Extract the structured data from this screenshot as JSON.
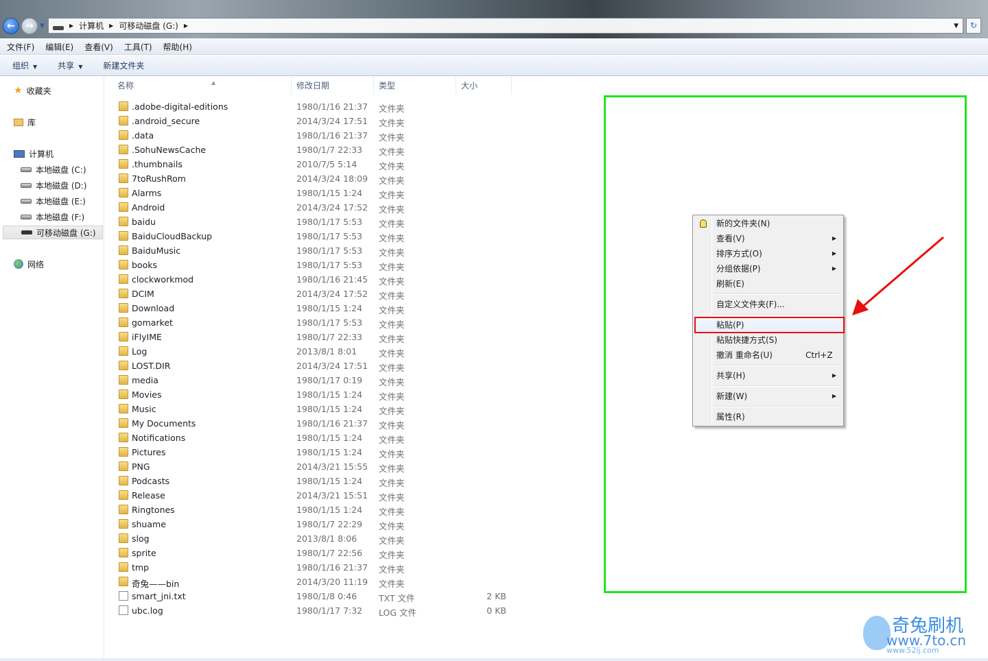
{
  "address": {
    "crumbs": [
      "计算机",
      "可移动磁盘 (G:)"
    ]
  },
  "menubar": [
    "文件(F)",
    "编辑(E)",
    "查看(V)",
    "工具(T)",
    "帮助(H)"
  ],
  "toolbar": {
    "organize": "组织",
    "share": "共享",
    "new_folder": "新建文件夹"
  },
  "sidebar": {
    "favorites": "收藏夹",
    "libraries": "库",
    "computer": "计算机",
    "drives": [
      "本地磁盘 (C:)",
      "本地磁盘 (D:)",
      "本地磁盘 (E:)",
      "本地磁盘 (F:)",
      "可移动磁盘 (G:)"
    ],
    "network": "网络"
  },
  "columns": {
    "name": "名称",
    "date": "修改日期",
    "type": "类型",
    "size": "大小"
  },
  "files": [
    {
      "name": ".adobe-digital-editions",
      "date": "1980/1/16 21:37",
      "type": "文件夹",
      "size": "",
      "kind": "folder"
    },
    {
      "name": ".android_secure",
      "date": "2014/3/24 17:51",
      "type": "文件夹",
      "size": "",
      "kind": "folder"
    },
    {
      "name": ".data",
      "date": "1980/1/16 21:37",
      "type": "文件夹",
      "size": "",
      "kind": "folder"
    },
    {
      "name": ".SohuNewsCache",
      "date": "1980/1/7 22:33",
      "type": "文件夹",
      "size": "",
      "kind": "folder"
    },
    {
      "name": ".thumbnails",
      "date": "2010/7/5 5:14",
      "type": "文件夹",
      "size": "",
      "kind": "folder"
    },
    {
      "name": "7toRushRom",
      "date": "2014/3/24 18:09",
      "type": "文件夹",
      "size": "",
      "kind": "folder"
    },
    {
      "name": "Alarms",
      "date": "1980/1/15 1:24",
      "type": "文件夹",
      "size": "",
      "kind": "folder"
    },
    {
      "name": "Android",
      "date": "2014/3/24 17:52",
      "type": "文件夹",
      "size": "",
      "kind": "folder"
    },
    {
      "name": "baidu",
      "date": "1980/1/17 5:53",
      "type": "文件夹",
      "size": "",
      "kind": "folder"
    },
    {
      "name": "BaiduCloudBackup",
      "date": "1980/1/17 5:53",
      "type": "文件夹",
      "size": "",
      "kind": "folder"
    },
    {
      "name": "BaiduMusic",
      "date": "1980/1/17 5:53",
      "type": "文件夹",
      "size": "",
      "kind": "folder"
    },
    {
      "name": "books",
      "date": "1980/1/17 5:53",
      "type": "文件夹",
      "size": "",
      "kind": "folder"
    },
    {
      "name": "clockworkmod",
      "date": "1980/1/16 21:45",
      "type": "文件夹",
      "size": "",
      "kind": "folder"
    },
    {
      "name": "DCIM",
      "date": "2014/3/24 17:52",
      "type": "文件夹",
      "size": "",
      "kind": "folder"
    },
    {
      "name": "Download",
      "date": "1980/1/15 1:24",
      "type": "文件夹",
      "size": "",
      "kind": "folder"
    },
    {
      "name": "gomarket",
      "date": "1980/1/17 5:53",
      "type": "文件夹",
      "size": "",
      "kind": "folder"
    },
    {
      "name": "iFlyIME",
      "date": "1980/1/7 22:33",
      "type": "文件夹",
      "size": "",
      "kind": "folder"
    },
    {
      "name": "Log",
      "date": "2013/8/1 8:01",
      "type": "文件夹",
      "size": "",
      "kind": "folder"
    },
    {
      "name": "LOST.DIR",
      "date": "2014/3/24 17:51",
      "type": "文件夹",
      "size": "",
      "kind": "folder"
    },
    {
      "name": "media",
      "date": "1980/1/17 0:19",
      "type": "文件夹",
      "size": "",
      "kind": "folder"
    },
    {
      "name": "Movies",
      "date": "1980/1/15 1:24",
      "type": "文件夹",
      "size": "",
      "kind": "folder"
    },
    {
      "name": "Music",
      "date": "1980/1/15 1:24",
      "type": "文件夹",
      "size": "",
      "kind": "folder"
    },
    {
      "name": "My Documents",
      "date": "1980/1/16 21:37",
      "type": "文件夹",
      "size": "",
      "kind": "folder"
    },
    {
      "name": "Notifications",
      "date": "1980/1/15 1:24",
      "type": "文件夹",
      "size": "",
      "kind": "folder"
    },
    {
      "name": "Pictures",
      "date": "1980/1/15 1:24",
      "type": "文件夹",
      "size": "",
      "kind": "folder"
    },
    {
      "name": "PNG",
      "date": "2014/3/21 15:55",
      "type": "文件夹",
      "size": "",
      "kind": "folder"
    },
    {
      "name": "Podcasts",
      "date": "1980/1/15 1:24",
      "type": "文件夹",
      "size": "",
      "kind": "folder"
    },
    {
      "name": "Release",
      "date": "2014/3/21 15:51",
      "type": "文件夹",
      "size": "",
      "kind": "folder"
    },
    {
      "name": "Ringtones",
      "date": "1980/1/15 1:24",
      "type": "文件夹",
      "size": "",
      "kind": "folder"
    },
    {
      "name": "shuame",
      "date": "1980/1/7 22:29",
      "type": "文件夹",
      "size": "",
      "kind": "folder"
    },
    {
      "name": "slog",
      "date": "2013/8/1 8:06",
      "type": "文件夹",
      "size": "",
      "kind": "folder"
    },
    {
      "name": "sprite",
      "date": "1980/1/7 22:56",
      "type": "文件夹",
      "size": "",
      "kind": "folder"
    },
    {
      "name": "tmp",
      "date": "1980/1/16 21:37",
      "type": "文件夹",
      "size": "",
      "kind": "folder"
    },
    {
      "name": "奇兔——bin",
      "date": "2014/3/20 11:19",
      "type": "文件夹",
      "size": "",
      "kind": "folder"
    },
    {
      "name": "smart_jni.txt",
      "date": "1980/1/8 0:46",
      "type": "TXT 文件",
      "size": "2 KB",
      "kind": "file"
    },
    {
      "name": "ubc.log",
      "date": "1980/1/17 7:32",
      "type": "LOG 文件",
      "size": "0 KB",
      "kind": "file"
    }
  ],
  "context_menu": {
    "items": [
      {
        "label": "新的文件夹(N)",
        "submenu": false,
        "icon": "bell-icon"
      },
      {
        "label": "查看(V)",
        "submenu": true
      },
      {
        "label": "排序方式(O)",
        "submenu": true
      },
      {
        "label": "分组依据(P)",
        "submenu": true
      },
      {
        "label": "刷新(E)",
        "submenu": false
      },
      {
        "separator": true
      },
      {
        "label": "自定义文件夹(F)...",
        "submenu": false
      },
      {
        "separator": true
      },
      {
        "label": "粘贴(P)",
        "submenu": false,
        "highlighted": true
      },
      {
        "label": "粘贴快捷方式(S)",
        "submenu": false
      },
      {
        "label": "撤消 重命名(U)",
        "shortcut": "Ctrl+Z",
        "submenu": false
      },
      {
        "separator": true
      },
      {
        "label": "共享(H)",
        "submenu": true
      },
      {
        "separator": true
      },
      {
        "label": "新建(W)",
        "submenu": true
      },
      {
        "separator": true
      },
      {
        "label": "属性(R)",
        "submenu": false
      }
    ]
  },
  "annotations": {
    "highlight_color": "#1ee61e",
    "callout_color": "#e81010"
  },
  "watermark": {
    "brand": "奇兔刷机",
    "url": "www.7to.cn",
    "url2": "www.52ij.com"
  }
}
